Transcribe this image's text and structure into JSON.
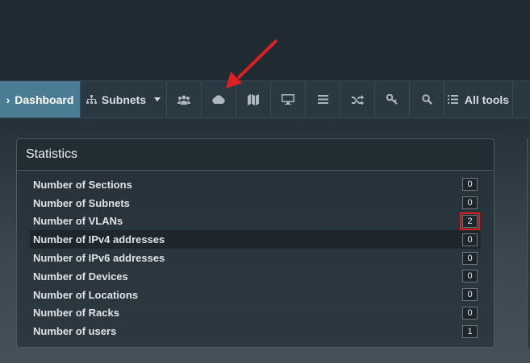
{
  "nav": {
    "dashboard": "Dashboard",
    "subnets": "Subnets",
    "icons": [
      "users-icon",
      "cloud-icon",
      "map-icon",
      "monitor-icon",
      "menu-icon",
      "shuffle-icon",
      "key-icon",
      "search-icon"
    ],
    "all_tools": "All tools"
  },
  "statistics": {
    "title": "Statistics",
    "rows": [
      {
        "label": "Number of Sections",
        "value": "0"
      },
      {
        "label": "Number of Subnets",
        "value": "0"
      },
      {
        "label": "Number of VLANs",
        "value": "2"
      },
      {
        "label": "Number of IPv4 addresses",
        "value": "0"
      },
      {
        "label": "Number of IPv6 addresses",
        "value": "0"
      },
      {
        "label": "Number of Devices",
        "value": "0"
      },
      {
        "label": "Number of Locations",
        "value": "0"
      },
      {
        "label": "Number of Racks",
        "value": "0"
      },
      {
        "label": "Number of users",
        "value": "1"
      }
    ]
  },
  "colors": {
    "active_nav": "#4a7d93",
    "annotation_red": "#e02020"
  }
}
